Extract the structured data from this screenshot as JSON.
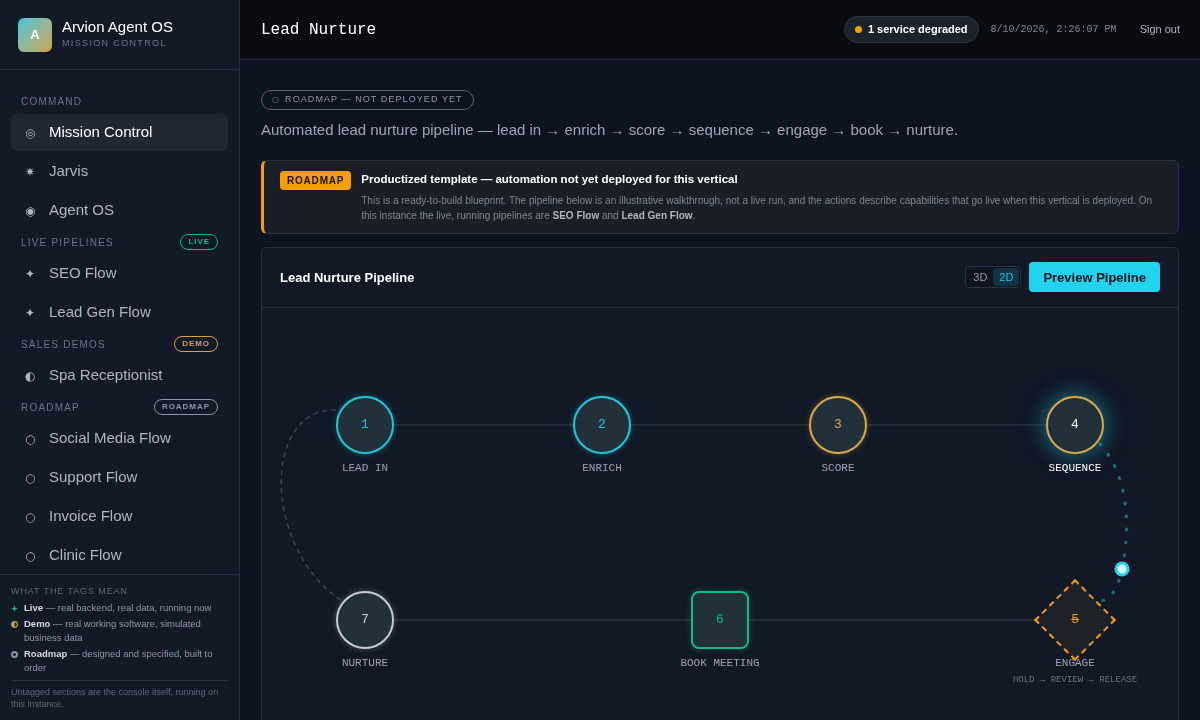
{
  "brand": {
    "logo_letter": "A",
    "name": "Arvion Agent OS",
    "subtitle": "MISSION CONTROL"
  },
  "sidebar": {
    "sections": [
      {
        "title": "COMMAND",
        "items": [
          {
            "icon": "◎",
            "label": "Mission Control",
            "selected": true
          },
          {
            "icon": "✷",
            "label": "Jarvis",
            "selected": false
          },
          {
            "icon": "◉",
            "label": "Agent OS",
            "selected": false
          }
        ]
      },
      {
        "title": "LIVE PIPELINES",
        "badge": {
          "label": "LIVE",
          "color": "#10b981"
        },
        "items": [
          {
            "icon": "✦",
            "label": "SEO Flow",
            "selected": false
          },
          {
            "icon": "✦",
            "label": "Lead Gen Flow",
            "selected": false
          }
        ]
      },
      {
        "title": "SALES DEMOS",
        "badge": {
          "label": "DEMO",
          "color": "#d4a24a"
        },
        "items": [
          {
            "icon": "◐",
            "label": "Spa Receptionist",
            "selected": false
          }
        ]
      },
      {
        "title": "ROADMAP",
        "badge": {
          "label": "ROADMAP",
          "color": "#8b93a7"
        },
        "items": [
          {
            "icon": "○",
            "label": "Social Media Flow",
            "selected": false
          },
          {
            "icon": "○",
            "label": "Support Flow",
            "selected": false
          },
          {
            "icon": "○",
            "label": "Invoice Flow",
            "selected": false
          },
          {
            "icon": "○",
            "label": "Clinic Flow",
            "selected": false
          }
        ]
      }
    ],
    "legend": {
      "title": "WHAT THE TAGS MEAN",
      "entries": [
        {
          "kind": "star",
          "color": "#10b981",
          "text": "**Live** — real backend, real data, running now"
        },
        {
          "kind": "half",
          "color": "#d4a24a",
          "text": "**Demo** — real working software, simulated business data"
        },
        {
          "kind": "ring",
          "color": "#8b93a7",
          "text": "**Roadmap** — designed and specified, built to order"
        }
      ],
      "note": "Untagged sections are the console itself, running on this instance."
    }
  },
  "header": {
    "title": "Lead Nurture",
    "status": {
      "label": "1 service degraded",
      "color": "#f59e0b"
    },
    "timestamp": "8/10/2026, 2:26:07 PM",
    "sign_out": "Sign out"
  },
  "status_tag": {
    "icon": "○",
    "label": "ROADMAP — NOT DEPLOYED YET"
  },
  "description": "Automated lead nurture pipeline — lead in → enrich → score → sequence → engage → book → nurture.",
  "notice": {
    "badge": "ROADMAP",
    "title": "Productized template — automation not yet deployed for this vertical",
    "body": "This is a ready-to-build blueprint. The pipeline below is an illustrative walkthrough, not a live run, and the actions describe capabilities that go live when this vertical is deployed. On this instance the live, running pipelines are **SEO Flow** and **Lead Gen Flow**."
  },
  "pipeline": {
    "title": "Lead Nurture Pipeline",
    "view_options": [
      {
        "label": "3D",
        "selected": false
      },
      {
        "label": "2D",
        "selected": true
      }
    ],
    "preview_button": "Preview Pipeline",
    "nodes": [
      {
        "number": "1",
        "label": "LEAD IN",
        "kind": "circle",
        "color": "#22c5dc",
        "selected": false
      },
      {
        "number": "2",
        "label": "ENRICH",
        "kind": "circle",
        "color": "#22c5dc",
        "selected": false
      },
      {
        "number": "3",
        "label": "SCORE",
        "kind": "circle",
        "color": "#d9a94a",
        "selected": false
      },
      {
        "number": "4",
        "label": "SEQUENCE",
        "kind": "circle",
        "color": "#d9a94a",
        "selected": true
      },
      {
        "number": "7",
        "label": "NURTURE",
        "kind": "circle",
        "color": "#c3c8d2",
        "selected": false
      },
      {
        "number": "6",
        "label": "BOOK MEETING",
        "kind": "square",
        "color": "#10b981",
        "selected": false
      },
      {
        "number": "5",
        "label": "ENGAGE",
        "sublabel": "HOLD → REVIEW → RELEASE",
        "kind": "diamond",
        "color": "#f59e0b",
        "selected": false
      }
    ]
  }
}
